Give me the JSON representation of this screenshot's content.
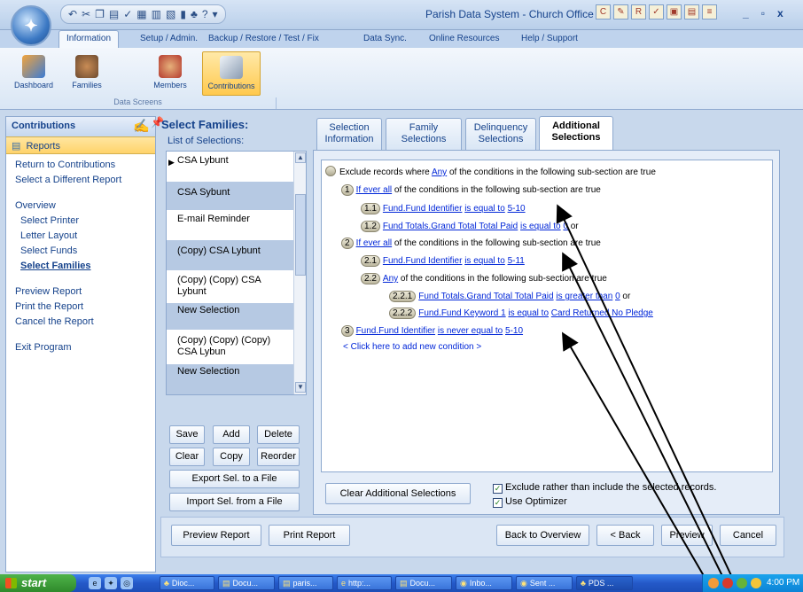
{
  "window": {
    "title": "Parish Data System - Church Office",
    "qat_icons": [
      "undo-icon",
      "cut-icon",
      "copy-icon",
      "paste-icon",
      "spell-icon",
      "grid-icon",
      "table-icon",
      "chart-icon",
      "book-icon",
      "group-icon",
      "help-icon"
    ],
    "minimize": "_",
    "maximize": "▫",
    "close": "x"
  },
  "ribbon": {
    "tabs": [
      {
        "label": "Information",
        "active": true
      },
      {
        "label": "Setup / Admin.",
        "active": false
      },
      {
        "label": "Backup / Restore / Test / Fix",
        "active": false
      },
      {
        "label": "Data Sync.",
        "active": false
      },
      {
        "label": "Online Resources",
        "active": false
      },
      {
        "label": "Help / Support",
        "active": false
      }
    ],
    "buttons": [
      {
        "label": "Dashboard",
        "icon": "dashboard-icon",
        "active": false
      },
      {
        "label": "Families",
        "icon": "families-icon",
        "active": false
      },
      {
        "label": "Members",
        "icon": "members-icon",
        "active": false
      },
      {
        "label": "Contributions",
        "icon": "contributions-icon",
        "active": true
      }
    ],
    "group_label": "Data Screens"
  },
  "leftnav": {
    "title": "Contributions",
    "section": "Reports",
    "items": [
      {
        "label": "Return to Contributions"
      },
      {
        "label": "Select a Different Report"
      },
      {
        "label": "Overview"
      },
      {
        "label": "Select Printer"
      },
      {
        "label": "Letter Layout"
      },
      {
        "label": "Select Funds"
      },
      {
        "label": "Select Families"
      },
      {
        "label": "Preview Report"
      },
      {
        "label": "Print the Report"
      },
      {
        "label": "Cancel the Report"
      },
      {
        "label": "Exit Program"
      }
    ]
  },
  "selections": {
    "title": "Select Families:",
    "subtitle": "List of Selections:",
    "items": [
      "CSA Lybunt",
      "CSA Sybunt",
      "E-mail Reminder",
      "(Copy) CSA Lybunt",
      "(Copy) (Copy) CSA Lybunt",
      "New Selection",
      "(Copy) (Copy) (Copy) CSA Lybun",
      "New Selection"
    ],
    "buttons": {
      "save": "Save",
      "add": "Add",
      "delete": "Delete",
      "clear": "Clear",
      "copy": "Copy",
      "reorder": "Reorder",
      "export": "Export Sel. to a File",
      "import": "Import  Sel. from a File"
    }
  },
  "tabs": [
    {
      "line1": "Selection",
      "line2": "Information",
      "active": false
    },
    {
      "line1": "Family",
      "line2": "Selections",
      "active": false
    },
    {
      "line1": "Delinquency",
      "line2": "Selections",
      "active": false
    },
    {
      "line1": "Additional",
      "line2": "Selections",
      "active": true
    }
  ],
  "conditions": {
    "root": {
      "prefix": "Exclude records where",
      "op": "Any",
      "suffix": "of the conditions in the following sub-section are true"
    },
    "c1": {
      "num": "1",
      "op": "If ever all",
      "suffix": "of the conditions in the following sub-section are true"
    },
    "c11": {
      "num": "1.1",
      "field": "Fund.Fund Identifier",
      "cmp": "is equal to",
      "value": "5-10",
      "join": ""
    },
    "c12": {
      "num": "1.2",
      "field": "Fund Totals.Grand Total Total Paid",
      "cmp": "is equal to",
      "value": "0",
      "join": "or"
    },
    "c2": {
      "num": "2",
      "op": "If ever all",
      "suffix": "of the conditions in the following sub-section are true"
    },
    "c21": {
      "num": "2.1",
      "field": "Fund.Fund Identifier",
      "cmp": "is equal to",
      "value": "5-11",
      "join": ""
    },
    "c22": {
      "num": "2.2",
      "op": "Any",
      "suffix": "of the conditions in the following sub-section are true"
    },
    "c221": {
      "num": "2.2.1",
      "field": "Fund Totals.Grand Total Total Paid",
      "cmp": "is greater than",
      "value": "0",
      "join": "or"
    },
    "c222": {
      "num": "2.2.2",
      "field": "Fund.Fund Keyword 1",
      "cmp": "is equal to",
      "value": "Card Returned No Pledge",
      "join": ""
    },
    "c3": {
      "num": "3",
      "field": "Fund.Fund Identifier",
      "cmp": "is never equal to",
      "value": "5-10",
      "join": ""
    },
    "add_condition": "< Click here to add new condition >"
  },
  "panel": {
    "clear_button": "Clear Additional Selections",
    "exclude_label": "Exclude rather than include the selected records.",
    "exclude_checked": true,
    "optimizer_label": "Use Optimizer",
    "optimizer_checked": true
  },
  "bottom": {
    "preview": "Preview Report",
    "print": "Print Report",
    "back_overview": "Back to Overview",
    "back": "< Back",
    "preview_small": "Preview",
    "cancel": "Cancel"
  },
  "taskbar": {
    "start": "start",
    "tasks": [
      "Dioc...",
      "Docu...",
      "paris...",
      "http:...",
      "Docu...",
      "Inbo...",
      "Sent ...",
      "PDS ..."
    ],
    "clock": "4:00 PM"
  }
}
